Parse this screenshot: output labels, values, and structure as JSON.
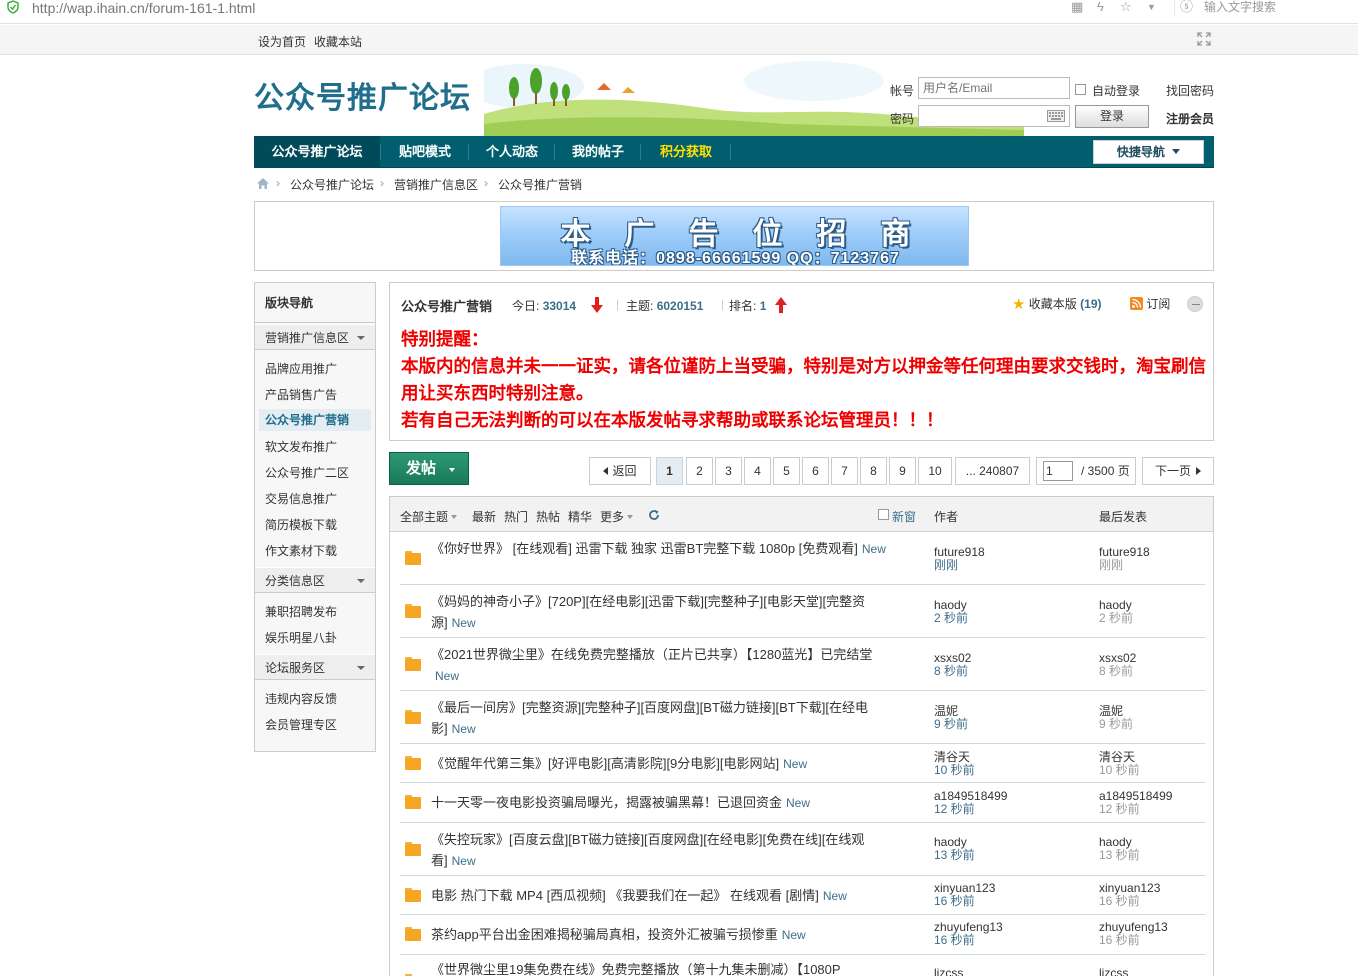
{
  "browser": {
    "url": "http://wap.ihain.cn/forum-161-1.html",
    "search_placeholder": "输入文字搜索"
  },
  "topbar": {
    "set_home": "设为首页",
    "bookmark": "收藏本站"
  },
  "header": {
    "logo": "公众号推广论坛",
    "account_label": "帐号",
    "account_placeholder": "用户名/Email",
    "password_label": "密码",
    "auto_login": "自动登录",
    "forgot_password": "找回密码",
    "login_button": "登录",
    "register": "注册会员"
  },
  "mainnav": {
    "items": [
      "公众号推广论坛",
      "贴吧模式",
      "个人动态",
      "我的帖子",
      "积分获取"
    ],
    "quick_nav": "快捷导航",
    "active_color": "#004b59",
    "highlight_color": "#ffe000"
  },
  "breadcrumb": [
    "公众号推广论坛",
    "营销推广信息区",
    "公众号推广营销"
  ],
  "ad": {
    "main": "本广告位招商",
    "sub": "联系电话：0898-66661599 QQ：7123767"
  },
  "sidebar": {
    "title": "版块导航",
    "groups": [
      {
        "label": "营销推广信息区",
        "items": [
          "品牌应用推广",
          "产品销售广告",
          "公众号推广营销",
          "软文发布推广",
          "公众号推广二区",
          "交易信息推广",
          "简历模板下载",
          "作文素材下载"
        ]
      },
      {
        "label": "分类信息区",
        "items": [
          "兼职招聘发布",
          "娱乐明星八卦"
        ]
      },
      {
        "label": "论坛服务区",
        "items": [
          "违规内容反馈",
          "会员管理专区"
        ]
      }
    ]
  },
  "forum": {
    "name": "公众号推广营销",
    "today_label": "今日:",
    "today": "33014",
    "topics_label": "主题:",
    "topics": "6020151",
    "rank_label": "排名:",
    "rank": "1",
    "favorite": "收藏本版",
    "favorite_count": "(19)",
    "subscribe": "订阅",
    "notice": [
      "特别提醒：",
      "本版内的信息并未一一证实，请各位谨防上当受骗，特别是对方以押金等任何理由要求交钱时，淘宝刷信用让买东西时特别注意。",
      "若有自己无法判断的可以在本版发帖寻求帮助或联系论坛管理员！！！"
    ]
  },
  "pager": {
    "post_button": "发帖",
    "back": "返回",
    "pages": [
      "1",
      "2",
      "3",
      "4",
      "5",
      "6",
      "7",
      "8",
      "9",
      "10"
    ],
    "last": "... 240807",
    "current": "1",
    "total": "/ 3500 页",
    "next": "下一页"
  },
  "table_head": {
    "all": "全部主题",
    "filters": [
      "最新",
      "热门",
      "热帖",
      "精华"
    ],
    "more": "更多",
    "new_window": "新窗",
    "author": "作者",
    "last_post": "最后发表"
  },
  "threads": [
    {
      "title": "《你好世界》 [在线观看] 迅雷下载 独家 迅雷BT完整下载 1080p [免费观看]",
      "new": "New",
      "author": "future918",
      "time": "刚刚",
      "last": "future918",
      "last_time": "刚刚"
    },
    {
      "title": "《妈妈的神奇小子》[720P][在经电影][迅雷下载][完整种子][电影天堂][完整资源]",
      "new": "New",
      "author": "haody",
      "time": "2 秒前",
      "last": "haody",
      "last_time": "2 秒前"
    },
    {
      "title": "《2021世界微尘里》在线免费完整播放（正片已共享）【1280蓝光】已完结堂",
      "new": "New",
      "author": "xsxs02",
      "time": "8 秒前",
      "last": "xsxs02",
      "last_time": "8 秒前"
    },
    {
      "title": "《最后一间房》[完整资源][完整种子][百度网盘][BT磁力链接][BT下载][在经电影]",
      "new": "New",
      "author": "温妮",
      "time": "9 秒前",
      "last": "温妮",
      "last_time": "9 秒前"
    },
    {
      "title": "《觉醒年代第三集》[好评电影][高清影院][9分电影][电影网站]",
      "new": "New",
      "author": "清谷天",
      "time": "10 秒前",
      "last": "清谷天",
      "last_time": "10 秒前"
    },
    {
      "title": "十一天零一夜电影投资骗局曝光，揭露被骗黑幕！已退回资金",
      "new": "New",
      "author": "a1849518499",
      "time": "12 秒前",
      "last": "a1849518499",
      "last_time": "12 秒前"
    },
    {
      "title": "《失控玩家》[百度云盘][BT磁力链接][百度网盘][在经电影][免费在线][在线观看]",
      "new": "New",
      "author": "haody",
      "time": "13 秒前",
      "last": "haody",
      "last_time": "13 秒前"
    },
    {
      "title": "电影 热门下载 MP4 [西瓜视频] 《我要我们在一起》 在线观看 [剧情]",
      "new": "New",
      "author": "xinyuan123",
      "time": "16 秒前",
      "last": "xinyuan123",
      "last_time": "16 秒前"
    },
    {
      "title": "茶约app平台出金困难揭秘骗局真相，投资外汇被骗亏损惨重",
      "new": "New",
      "author": "zhuyufeng13",
      "time": "16 秒前",
      "last": "zhuyufeng13",
      "last_time": "16 秒前"
    },
    {
      "title": "《世界微尘里19集免费在线》免费完整播放（第十九集未删减）【1080P",
      "new": "",
      "author": "lizcss",
      "time": "",
      "last": "lizcss",
      "last_time": ""
    }
  ]
}
